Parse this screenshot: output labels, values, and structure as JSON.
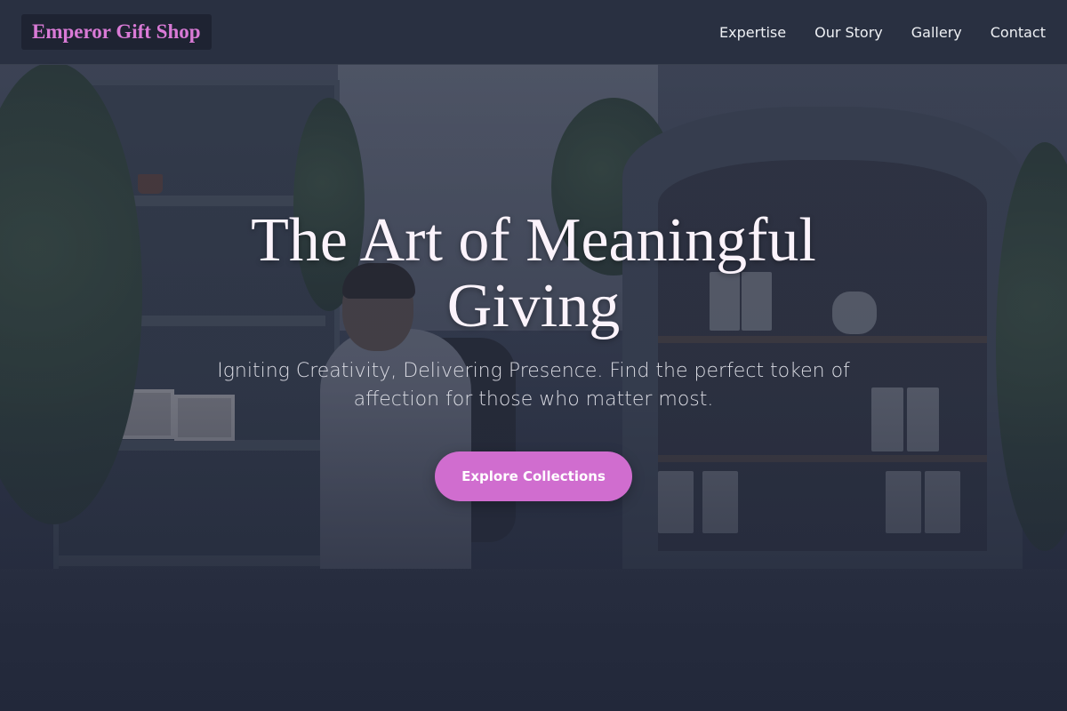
{
  "brand": {
    "name": "Emperor Gift Shop",
    "accent_color": "#d06dcf"
  },
  "nav": {
    "links": [
      {
        "label": "Expertise"
      },
      {
        "label": "Our Story"
      },
      {
        "label": "Gallery"
      },
      {
        "label": "Contact"
      }
    ]
  },
  "hero": {
    "title": "The Art of Meaningful Giving",
    "subtitle": "Igniting Creativity, Delivering Presence. Find the perfect token of affection for those who matter most.",
    "cta_label": "Explore Collections",
    "background_image": "gift-shop-interior-photo"
  }
}
